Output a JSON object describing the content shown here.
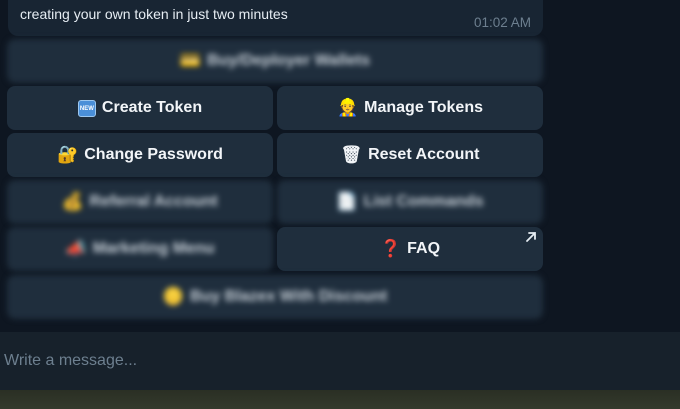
{
  "message": {
    "text": "creating your own token in just two minutes",
    "time": "01:02 AM"
  },
  "keyboard": {
    "buy_deployer_wallets": {
      "icon": "💳",
      "label": "Buy/Deployer Wallets"
    },
    "create_token": {
      "icon": "new-badge",
      "badge": "NEW",
      "label": "Create Token"
    },
    "manage_tokens": {
      "icon": "👷",
      "label": "Manage Tokens"
    },
    "change_password": {
      "icon": "🔐",
      "label": "Change Password"
    },
    "reset_account": {
      "icon": "🗑",
      "label": "Reset Account"
    },
    "referral_account": {
      "icon": "💰",
      "label": "Referral Account"
    },
    "list_commands": {
      "icon": "📄",
      "label": "List Commands"
    },
    "marketing_menu": {
      "icon": "📣",
      "label": "Marketing Menu"
    },
    "faq": {
      "icon": "❓",
      "label": "FAQ"
    },
    "buy_discount": {
      "icon": "🪙",
      "label": "Buy Blazex With Discount"
    }
  },
  "composer": {
    "placeholder": "Write a message..."
  }
}
